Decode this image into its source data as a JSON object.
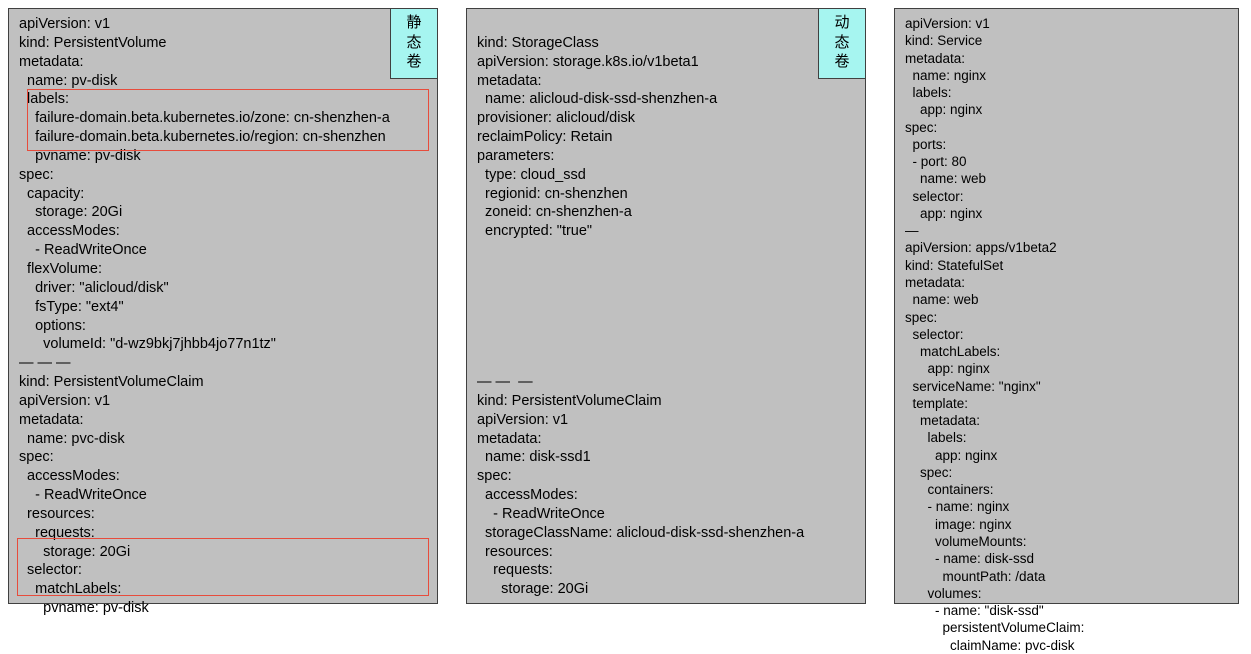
{
  "panel1": {
    "badge_l1": "静",
    "badge_l2": "态",
    "badge_l3": "卷",
    "content": "apiVersion: v1\nkind: PersistentVolume\nmetadata:\n  name: pv-disk\n  labels:\n    failure-domain.beta.kubernetes.io/zone: cn-shenzhen-a\n    failure-domain.beta.kubernetes.io/region: cn-shenzhen\n    pvname: pv-disk\nspec:\n  capacity:\n    storage: 20Gi\n  accessModes:\n    - ReadWriteOnce\n  flexVolume:\n    driver: \"alicloud/disk\"\n    fsType: \"ext4\"\n    options:\n      volumeId: \"d-wz9bkj7jhbb4jo77n1tz\"\n— — —\nkind: PersistentVolumeClaim\napiVersion: v1\nmetadata:\n  name: pvc-disk\nspec:\n  accessModes:\n    - ReadWriteOnce\n  resources:\n    requests:\n      storage: 20Gi\n  selector:\n    matchLabels:\n      pvname: pv-disk"
  },
  "panel2": {
    "badge_l1": "动",
    "badge_l2": "态",
    "badge_l3": "卷",
    "content": "\nkind: StorageClass\napiVersion: storage.k8s.io/v1beta1\nmetadata:\n  name: alicloud-disk-ssd-shenzhen-a\nprovisioner: alicloud/disk\nreclaimPolicy: Retain\nparameters:\n  type: cloud_ssd\n  regionid: cn-shenzhen\n  zoneid: cn-shenzhen-a\n  encrypted: \"true\"\n\n\n\n\n\n\n\n— —  —\nkind: PersistentVolumeClaim\napiVersion: v1\nmetadata:\n  name: disk-ssd1\nspec:\n  accessModes:\n    - ReadWriteOnce\n  storageClassName: alicloud-disk-ssd-shenzhen-a\n  resources:\n    requests:\n      storage: 20Gi"
  },
  "panel3": {
    "content": "apiVersion: v1\nkind: Service\nmetadata:\n  name: nginx\n  labels:\n    app: nginx\nspec:\n  ports:\n  - port: 80\n    name: web\n  selector:\n    app: nginx\n—\napiVersion: apps/v1beta2\nkind: StatefulSet\nmetadata:\n  name: web\nspec:\n  selector:\n    matchLabels:\n      app: nginx\n  serviceName: \"nginx\"\n  template:\n    metadata:\n      labels:\n        app: nginx\n    spec:\n      containers:\n      - name: nginx\n        image: nginx\n        volumeMounts:\n        - name: disk-ssd\n          mountPath: /data\n      volumes:\n        - name: \"disk-ssd\"\n          persistentVolumeClaim:\n            claimName: pvc-disk"
  }
}
